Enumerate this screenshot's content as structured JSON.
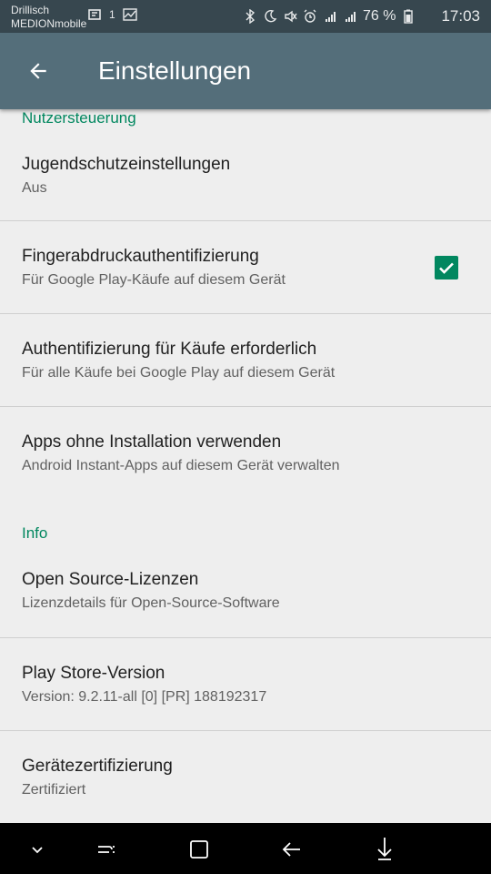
{
  "status_bar": {
    "carrier_line1": "Drillisch",
    "carrier_line2": "MEDIONmobile",
    "notification_count": "1",
    "battery_percent": "76 %",
    "time": "17:03",
    "icons": [
      "data-saver-icon",
      "activity-icon",
      "bluetooth-icon",
      "do-not-disturb-moon-icon",
      "vibrate-mute-icon",
      "alarm-icon",
      "signal-4g-icon",
      "signal-icon",
      "battery-icon"
    ]
  },
  "app_bar": {
    "title": "Einstellungen"
  },
  "sections": [
    {
      "header": "Nutzersteuerung",
      "items": [
        {
          "title": "Jugendschutzeinstellungen",
          "subtitle": "Aus"
        },
        {
          "title": "Fingerabdruckauthentifizierung",
          "subtitle": "Für Google Play-Käufe auf diesem Gerät",
          "checked": true
        },
        {
          "title": "Authentifizierung für Käufe erforderlich",
          "subtitle": "Für alle Käufe bei Google Play auf diesem Gerät"
        },
        {
          "title": "Apps ohne Installation verwenden",
          "subtitle": "Android Instant-Apps auf diesem Gerät verwalten"
        }
      ]
    },
    {
      "header": "Info",
      "items": [
        {
          "title": "Open Source-Lizenzen",
          "subtitle": "Lizenzdetails für Open-Source-Software"
        },
        {
          "title": "Play Store-Version",
          "subtitle": "Version: 9.2.11-all [0] [PR] 188192317"
        },
        {
          "title": "Gerätezertifizierung",
          "subtitle": "Zertifiziert"
        }
      ]
    }
  ],
  "nav_bar": {
    "buttons": [
      "hide-navbar-icon",
      "recents-icon",
      "home-icon",
      "back-icon",
      "pin-icon"
    ]
  },
  "colors": {
    "status_bar": "#37474f",
    "app_bar": "#546e7a",
    "accent": "#01875f",
    "background": "#eeeeee"
  }
}
